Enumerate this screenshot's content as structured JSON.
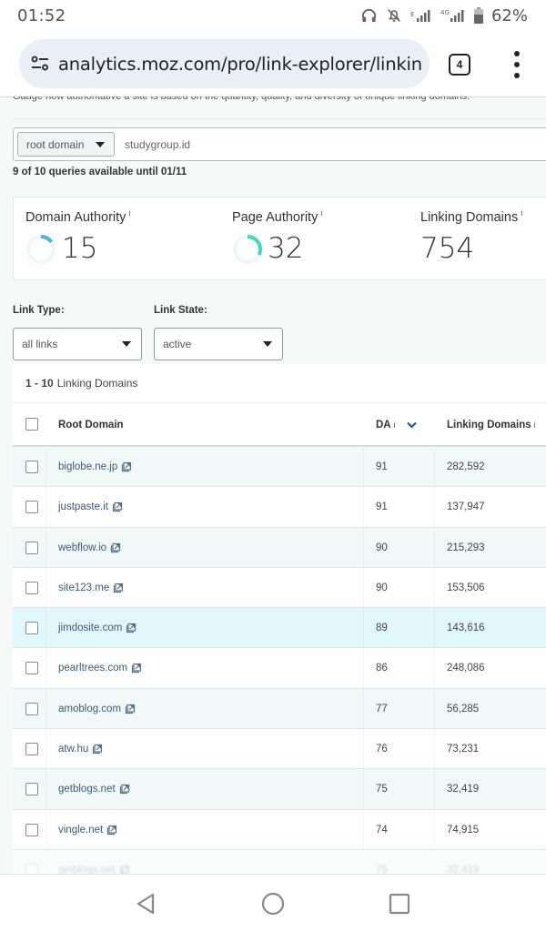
{
  "status_bar": {
    "time": "01:52",
    "icons": [
      "headphones-icon",
      "notifications-muted-icon",
      "signal-e-icon",
      "signal-4g-icon",
      "battery-icon"
    ],
    "battery_percent": "62%"
  },
  "browser": {
    "url": "analytics.moz.com/pro/link-explorer/linkin",
    "tab_count": "4",
    "site_settings_icon": "tune-icon",
    "menu_icon": "more-vert-icon"
  },
  "page": {
    "clipped_description": "Gauge how authoritative a site is based on the quantity, quality, and diversity of unique linking domains.",
    "search": {
      "scope_selected": "root domain",
      "query_value": "studygroup.id"
    },
    "quota_text": "9 of 10 queries available until 01/11",
    "metrics": [
      {
        "label": "Domain Authority",
        "info": "i",
        "value": "15",
        "gauge_fraction": 0.15,
        "gauge_color": "#4db3e8"
      },
      {
        "label": "Page Authority",
        "info": "i",
        "value": "32",
        "gauge_fraction": 0.32,
        "gauge_color": "#3fd9c2"
      },
      {
        "label": "Linking Domains",
        "info": "i",
        "value": "754"
      }
    ],
    "filters": {
      "link_type": {
        "label": "Link Type:",
        "selected": "all links"
      },
      "link_state": {
        "label": "Link State:",
        "selected": "active"
      }
    },
    "results": {
      "range": "1 - 10",
      "range_label": "Linking Domains",
      "columns": [
        {
          "label": "Root Domain"
        },
        {
          "label": "DA",
          "info": "i",
          "sorted": "desc"
        },
        {
          "label": "Linking Domains",
          "info": "i"
        }
      ],
      "rows": [
        {
          "domain": "biglobe.ne.jp",
          "da": "91",
          "linking_domains": "282,592"
        },
        {
          "domain": "justpaste.it",
          "da": "91",
          "linking_domains": "137,947"
        },
        {
          "domain": "webflow.io",
          "da": "90",
          "linking_domains": "215,293"
        },
        {
          "domain": "site123.me",
          "da": "90",
          "linking_domains": "153,506"
        },
        {
          "domain": "jimdosite.com",
          "da": "89",
          "linking_domains": "143,616"
        },
        {
          "domain": "pearltrees.com",
          "da": "86",
          "linking_domains": "248,086"
        },
        {
          "domain": "amoblog.com",
          "da": "77",
          "linking_domains": "56,285"
        },
        {
          "domain": "atw.hu",
          "da": "76",
          "linking_domains": "73,231"
        },
        {
          "domain": "getblogs.net",
          "da": "75",
          "linking_domains": "32,419"
        },
        {
          "domain": "vingle.net",
          "da": "74",
          "linking_domains": "74,915"
        }
      ]
    }
  },
  "nav_bar": {
    "buttons": [
      "back-icon",
      "home-icon",
      "recents-icon"
    ]
  }
}
